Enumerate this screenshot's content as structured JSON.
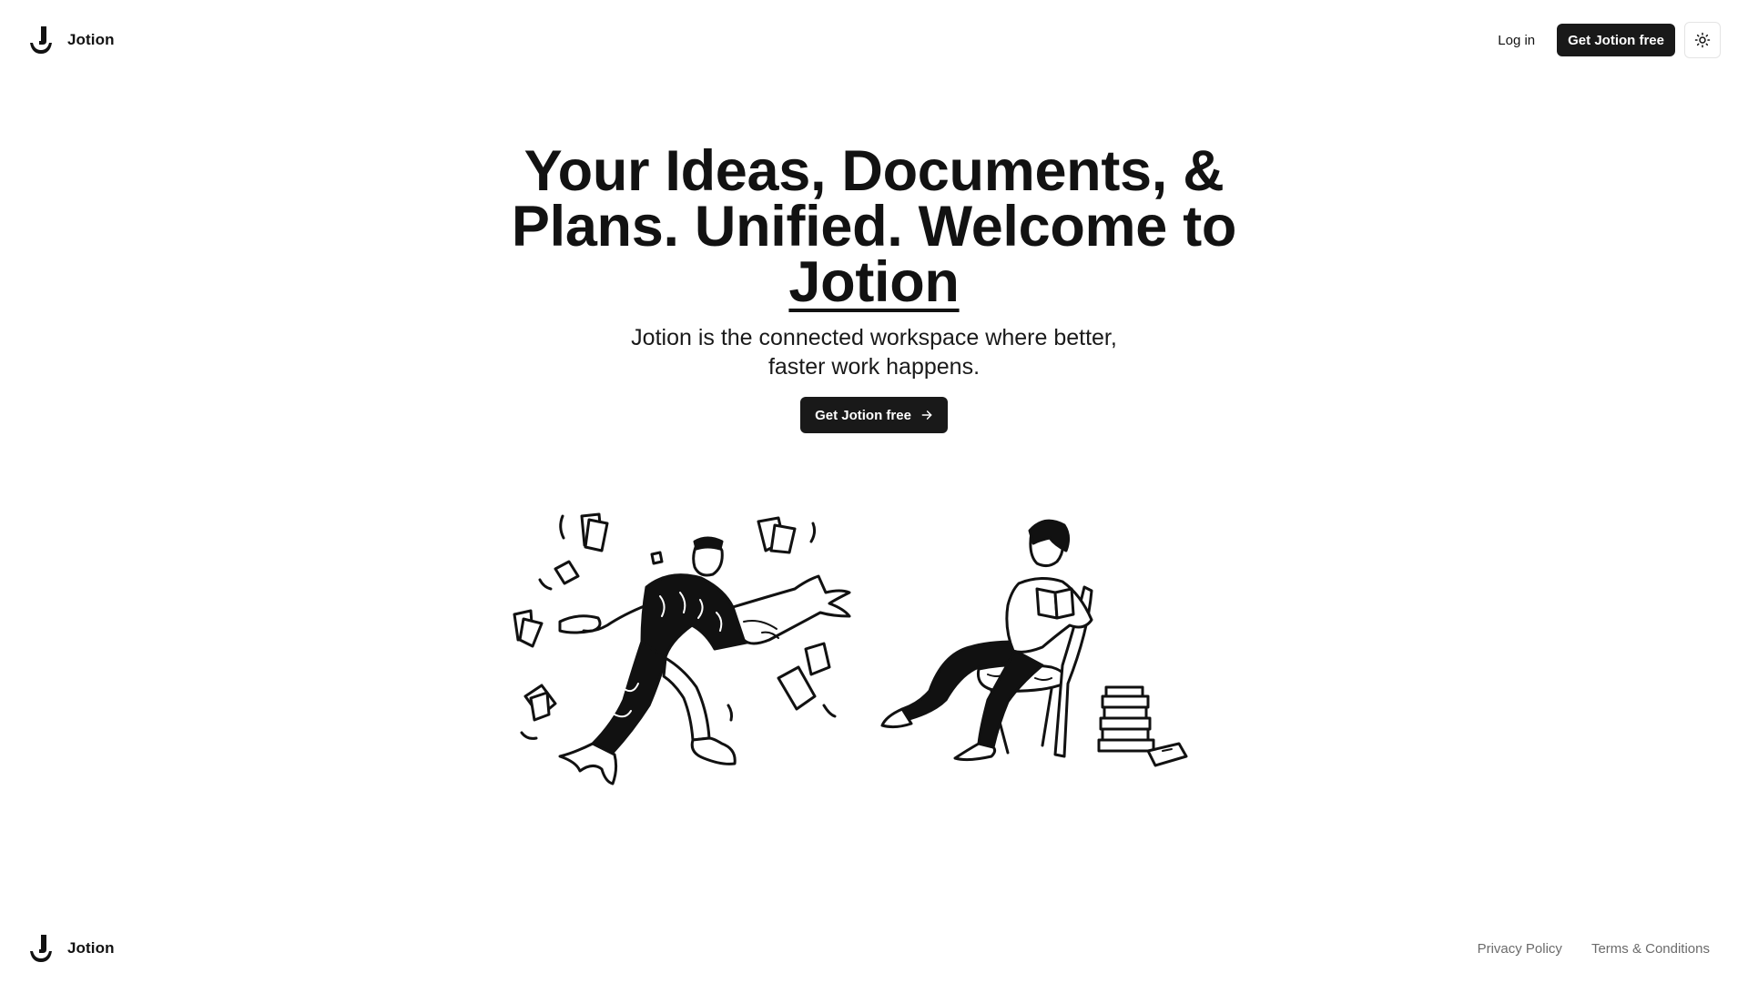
{
  "header": {
    "brand_name": "Jotion",
    "login_label": "Log in",
    "cta_label": "Get Jotion free",
    "theme_icon": "sun-icon"
  },
  "hero": {
    "title_line": "Your Ideas, Documents, & Plans. Unified. Welcome to",
    "title_highlight": "Jotion",
    "subtitle": "Jotion is the connected workspace where better, faster work happens.",
    "cta_label": "Get Jotion free",
    "cta_icon": "arrow-right-icon"
  },
  "illustrations": {
    "left": "person-juggling-papers-illustration",
    "right": "person-reading-in-chair-illustration"
  },
  "footer": {
    "brand_name": "Jotion",
    "privacy_label": "Privacy Policy",
    "terms_label": "Terms & Conditions"
  },
  "colors": {
    "primary": "#191919",
    "text": "#121212",
    "muted": "#6b6b6b",
    "background": "#ffffff"
  }
}
